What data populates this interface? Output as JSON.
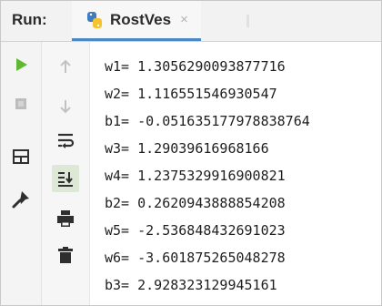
{
  "header": {
    "run_label": "Run:",
    "tab_title": "RostVes",
    "tab_close": "×"
  },
  "toolbar_left": [
    {
      "name": "run-icon",
      "icon": "play"
    },
    {
      "name": "stop-icon",
      "icon": "stop"
    },
    {
      "name": "layout-icon",
      "icon": "layout"
    },
    {
      "name": "pin-icon",
      "icon": "pin"
    }
  ],
  "toolbar_right": [
    {
      "name": "up-arrow-icon",
      "icon": "arrow-up"
    },
    {
      "name": "down-arrow-icon",
      "icon": "arrow-down"
    },
    {
      "name": "soft-wrap-icon",
      "icon": "wrap"
    },
    {
      "name": "scroll-to-end-icon",
      "icon": "scroll-end"
    },
    {
      "name": "print-icon",
      "icon": "printer"
    },
    {
      "name": "trash-icon",
      "icon": "trash"
    }
  ],
  "console": {
    "lines": [
      "w1= 1.3056290093877716",
      "w2= 1.116551546930547",
      "b1= -0.051635177978838764",
      "w3= 1.29039616968166",
      "w4= 1.2375329916900821",
      "b2= 0.2620943888854208",
      "w5= -2.536848432691023",
      "w6= -3.601875265048278",
      "b3= 2.928323129945161"
    ]
  },
  "colors": {
    "accent": "#4a88c7",
    "run_green": "#5fb832",
    "icon_dark": "#2f2f2f",
    "icon_disabled": "#b9b9b9"
  }
}
